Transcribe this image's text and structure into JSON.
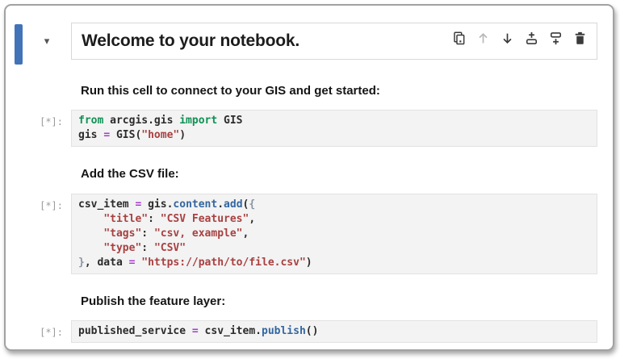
{
  "colors": {
    "accent-blue": "#4273b8",
    "kw": "#0f9154",
    "op": "#a43ccf",
    "str": "#a94040",
    "attr": "#33669f",
    "brace": "#8a94a5",
    "code-text": "#2b2b2b",
    "icon-dark": "#3a3a3a",
    "icon-disabled": "#b8b8b8"
  },
  "header": {
    "title": "Welcome to your notebook.",
    "collapse_glyph": "▾",
    "toolbar": [
      {
        "name": "duplicate-cell-button",
        "icon": "duplicate-icon",
        "enabled": true
      },
      {
        "name": "move-cell-up-button",
        "icon": "arrow-up-icon",
        "enabled": false
      },
      {
        "name": "move-cell-down-button",
        "icon": "arrow-down-icon",
        "enabled": true
      },
      {
        "name": "add-cell-above-button",
        "icon": "add-cell-above-icon",
        "enabled": true
      },
      {
        "name": "add-cell-below-button",
        "icon": "add-cell-below-icon",
        "enabled": true
      },
      {
        "name": "delete-cell-button",
        "icon": "trash-icon",
        "enabled": true
      }
    ]
  },
  "sections": [
    {
      "heading": "Run this cell to connect to your GIS and get started:",
      "prompt": "[*]:",
      "code": [
        [
          {
            "t": "from",
            "c": "kw"
          },
          {
            "t": " arcgis.gis ",
            "c": ""
          },
          {
            "t": "import",
            "c": "kw"
          },
          {
            "t": " GIS",
            "c": ""
          }
        ],
        [
          {
            "t": "gis ",
            "c": ""
          },
          {
            "t": "=",
            "c": "op"
          },
          {
            "t": " GIS(",
            "c": ""
          },
          {
            "t": "\"home\"",
            "c": "str"
          },
          {
            "t": ")",
            "c": ""
          }
        ]
      ]
    },
    {
      "heading": "Add the CSV file:",
      "prompt": "[*]:",
      "code": [
        [
          {
            "t": "csv_item ",
            "c": ""
          },
          {
            "t": "=",
            "c": "op"
          },
          {
            "t": " gis.",
            "c": ""
          },
          {
            "t": "content",
            "c": "attr"
          },
          {
            "t": ".",
            "c": ""
          },
          {
            "t": "add",
            "c": "attr"
          },
          {
            "t": "(",
            "c": ""
          },
          {
            "t": "{",
            "c": "brace"
          }
        ],
        [
          {
            "t": "    ",
            "c": ""
          },
          {
            "t": "\"title\"",
            "c": "str"
          },
          {
            "t": ": ",
            "c": ""
          },
          {
            "t": "\"CSV Features\"",
            "c": "str"
          },
          {
            "t": ",",
            "c": ""
          }
        ],
        [
          {
            "t": "    ",
            "c": ""
          },
          {
            "t": "\"tags\"",
            "c": "str"
          },
          {
            "t": ": ",
            "c": ""
          },
          {
            "t": "\"csv, example\"",
            "c": "str"
          },
          {
            "t": ",",
            "c": ""
          }
        ],
        [
          {
            "t": "    ",
            "c": ""
          },
          {
            "t": "\"type\"",
            "c": "str"
          },
          {
            "t": ": ",
            "c": ""
          },
          {
            "t": "\"CSV\"",
            "c": "str"
          }
        ],
        [
          {
            "t": "}",
            "c": "brace"
          },
          {
            "t": ", data ",
            "c": ""
          },
          {
            "t": "=",
            "c": "op"
          },
          {
            "t": " ",
            "c": ""
          },
          {
            "t": "\"https://path/to/file.csv\"",
            "c": "str"
          },
          {
            "t": ")",
            "c": ""
          }
        ]
      ]
    },
    {
      "heading": "Publish the feature layer:",
      "prompt": "[*]:",
      "code": [
        [
          {
            "t": "published_service ",
            "c": ""
          },
          {
            "t": "=",
            "c": "op"
          },
          {
            "t": " csv_item.",
            "c": ""
          },
          {
            "t": "publish",
            "c": "attr"
          },
          {
            "t": "()",
            "c": ""
          }
        ]
      ]
    }
  ]
}
